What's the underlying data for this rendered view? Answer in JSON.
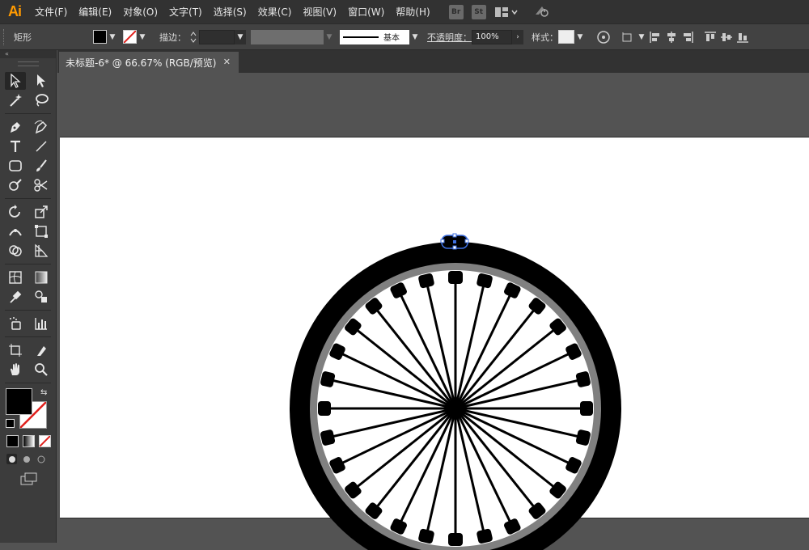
{
  "app": {
    "logo": "Ai"
  },
  "menu": [
    "文件(F)",
    "编辑(E)",
    "对象(O)",
    "文字(T)",
    "选择(S)",
    "效果(C)",
    "视图(V)",
    "窗口(W)",
    "帮助(H)"
  ],
  "menubar_icons": {
    "bridge": "Br",
    "stock": "St",
    "arrange_icon": "arrange-documents-icon",
    "sync_icon": "gpu-sync-icon"
  },
  "control_bar": {
    "object_type": "矩形",
    "fill_color": "#000000",
    "stroke_label": "描边：",
    "stroke_weight": "",
    "brush_label": "基本",
    "opacity_label": "不透明度：",
    "opacity_value": "100%",
    "style_label": "样式："
  },
  "document": {
    "tab_title": "未标题-6* @ 66.67% (RGB/预览)"
  },
  "colors": {
    "accent_orange": "#ff9a00",
    "selection_blue": "#3d6fe0",
    "tire": "#000000",
    "rim": "#808080"
  },
  "tools": [
    [
      "selection-tool-icon",
      "direct-selection-tool-icon"
    ],
    [
      "magic-wand-tool-icon",
      "lasso-tool-icon"
    ],
    [
      "pen-tool-icon",
      "curvature-tool-icon"
    ],
    [
      "type-tool-icon",
      "line-segment-tool-icon"
    ],
    [
      "rectangle-tool-icon",
      "paintbrush-tool-icon"
    ],
    [
      "shaper-tool-icon",
      "scissors-tool-icon"
    ],
    [
      "rotate-tool-icon",
      "scale-tool-icon"
    ],
    [
      "width-tool-icon",
      "free-transform-tool-icon"
    ],
    [
      "shape-builder-tool-icon",
      "perspective-grid-tool-icon"
    ],
    [
      "mesh-tool-icon",
      "gradient-tool-icon"
    ],
    [
      "eyedropper-tool-icon",
      "blend-tool-icon"
    ],
    [
      "symbol-sprayer-tool-icon",
      "column-graph-tool-icon"
    ],
    [
      "artboard-tool-icon",
      "slice-tool-icon"
    ],
    [
      "hand-tool-icon",
      "zoom-tool-icon"
    ]
  ]
}
